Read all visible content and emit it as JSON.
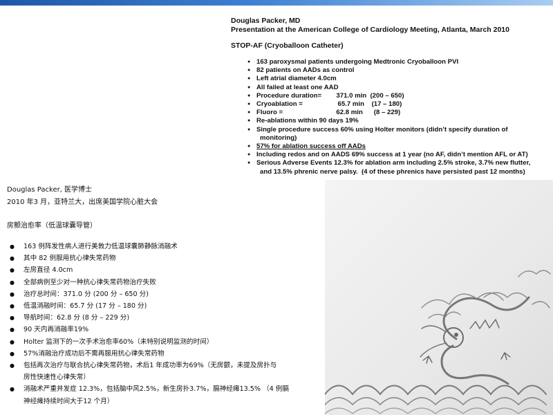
{
  "english": {
    "header_line1": "Douglas Packer, MD",
    "header_line2": "Presentation at the American College of Cardiology Meeting, Atlanta, March 2010",
    "subtitle": "STOP-AF (Cryoballoon Catheter)",
    "bullets": [
      {
        "text": "163 paroxysmal patients undergoing Medtronic Cryoballoon PVI"
      },
      {
        "text": "82 patients on AADs as control"
      },
      {
        "text": "Left atrial diameter 4.0cm"
      },
      {
        "text": "All failed at least one AAD"
      },
      {
        "text": "Procedure duration=        371.0 min  (200 – 650)"
      },
      {
        "text": "Cryoablation =                   65.7 min    (17 – 180)"
      },
      {
        "text": "Fluoro =                             62.8 min      (8 – 229)"
      },
      {
        "text": "Re-ablations within 90 days 19%"
      },
      {
        "text": "Single procedure success 60% using Holter monitors (didn’t specify duration of",
        "cont": "monitoring)"
      },
      {
        "text": "57% for ablation success off AADs"
      },
      {
        "text": "Including redos and on AADS 69% success at 1 year (no AF, didn’t mention AFL or AT)"
      },
      {
        "text": "Serious Adverse Events 12.3% for ablation arm including 2.5% stroke, 3.7% new flutter,",
        "cont": "and 13.5% phrenic nerve palsy.  (4 of these phrenics have persisted past 12 months)"
      }
    ]
  },
  "chinese": {
    "header_line1": "Douglas Packer,  医学博士",
    "header_line2": "2010  年3  月，亚特兰大，出席美国学院心脏大会",
    "subtitle": "房颤治愈率（低温球囊导管）",
    "bullets": [
      {
        "text": "163  例阵发性病人进行美敦力低温球囊肺静脉消融术"
      },
      {
        "text": "其中  82  例服用抗心律失常药物"
      },
      {
        "text": "左房直径  4.0cm"
      },
      {
        "text": "全部病例至少对一种抗心律失常药物治疗失败"
      },
      {
        "text": "治疗总时间：371.0  分  (200  分 – 650  分)"
      },
      {
        "text": "低温消融时间：65.7  分  (17  分 – 180  分)"
      },
      {
        "text": "导航时间：62.8  分  (8  分 – 229  分)"
      },
      {
        "text": "90  天内再消融率19%"
      },
      {
        "text": "Holter  监测下的一次手术治愈率60%（未特别说明监测的时间）"
      },
      {
        "text": "57%消融治疗成功后不需再服用抗心律失常药物"
      },
      {
        "text": "包括再次治疗与联合抗心律失常药物，术后1  年成功率为69%（无房颤，未提及房扑与",
        "cont": "房性快速性心律失常）"
      },
      {
        "text": "消融术严重并发症  12.3%，包括脑中风2.5%，新生房扑3.7%，膈神经瘫13.5%  （4  例膈",
        "cont": "神经瘫持续时间大于12  个月）"
      }
    ]
  },
  "colors": {
    "top_bar": "#1f57a8",
    "text": "#111111",
    "dragon_bg": "#e9e9e9",
    "dragon_ink": "#8a8a8a"
  },
  "decoration": {
    "top_bar": "blue-gradient-bar",
    "bottom_right": "dragon-and-waves-illustration"
  }
}
